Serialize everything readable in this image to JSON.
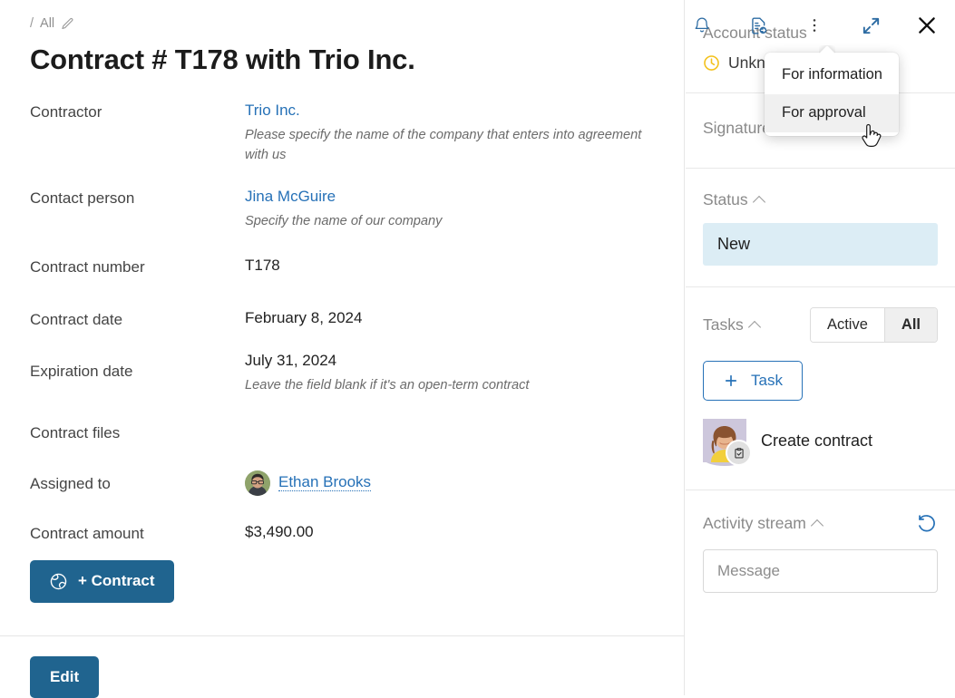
{
  "toolbar": {
    "icons": [
      {
        "name": "bell-icon",
        "label": "Notifications"
      },
      {
        "name": "document-share-icon",
        "label": "Send document"
      },
      {
        "name": "more-vertical-icon",
        "label": "More actions"
      },
      {
        "name": "expand-icon",
        "label": "Expand"
      },
      {
        "name": "close-icon",
        "label": "Close"
      }
    ]
  },
  "dropdown": {
    "items": [
      {
        "label": "For information",
        "hovered": false
      },
      {
        "label": "For approval",
        "hovered": true
      }
    ]
  },
  "breadcrumb": {
    "separator": "/",
    "crumb": "All",
    "edit_icon": "pencil-icon"
  },
  "page_title": "Contract # T178 with Trio Inc.",
  "fields": [
    {
      "label": "Contractor",
      "value": "Trio Inc.",
      "value_type": "link",
      "hint": "Please specify the name of the company that enters into agreement with us"
    },
    {
      "label": "Contact person",
      "value": "Jina McGuire",
      "value_type": "link",
      "hint": "Specify the name of our company"
    },
    {
      "label": "Contract number",
      "value": "T178",
      "value_type": "text",
      "hint": ""
    },
    {
      "label": "Contract date",
      "value": "February 8, 2024",
      "value_type": "text",
      "hint": ""
    },
    {
      "label": "Expiration date",
      "value": "July 31, 2024",
      "value_type": "text",
      "hint": "Leave the field blank if it's an open-term contract"
    },
    {
      "label": "Contract files",
      "value": "",
      "value_type": "text",
      "hint": ""
    },
    {
      "label": "Assigned to",
      "value": "Ethan Brooks",
      "value_type": "user",
      "hint": ""
    },
    {
      "label": "Contract amount",
      "value": "$3,490.00",
      "value_type": "text",
      "hint": ""
    }
  ],
  "buttons": {
    "add_contract": "+ Contract",
    "add_contract_icon": "globe-icon",
    "edit": "Edit"
  },
  "sidebar": {
    "account_status": {
      "title": "Account status",
      "title_visible": "Account s",
      "value": "Unknown",
      "icon": "clock-icon",
      "icon_color": "#f3c11b"
    },
    "signature_status": {
      "title": "Signature status"
    },
    "status": {
      "title": "Status",
      "value": "New",
      "chip_color": "#dcedf5"
    },
    "tasks": {
      "title": "Tasks",
      "filters": [
        {
          "label": "Active",
          "active": false
        },
        {
          "label": "All",
          "active": true
        }
      ],
      "add_button": "Task",
      "add_button_icon": "plus-icon",
      "items": [
        {
          "title": "Create contract",
          "badge_icon": "clipboard-check-icon"
        }
      ]
    },
    "activity_stream": {
      "title": "Activity stream",
      "refresh_icon": "refresh-ccw-icon",
      "message_placeholder": "Message",
      "message_value": ""
    }
  },
  "colors": {
    "primary": "#20648f",
    "link": "#2671b7",
    "accent_warning": "#f3c11b",
    "status_chip": "#dcedf5"
  }
}
